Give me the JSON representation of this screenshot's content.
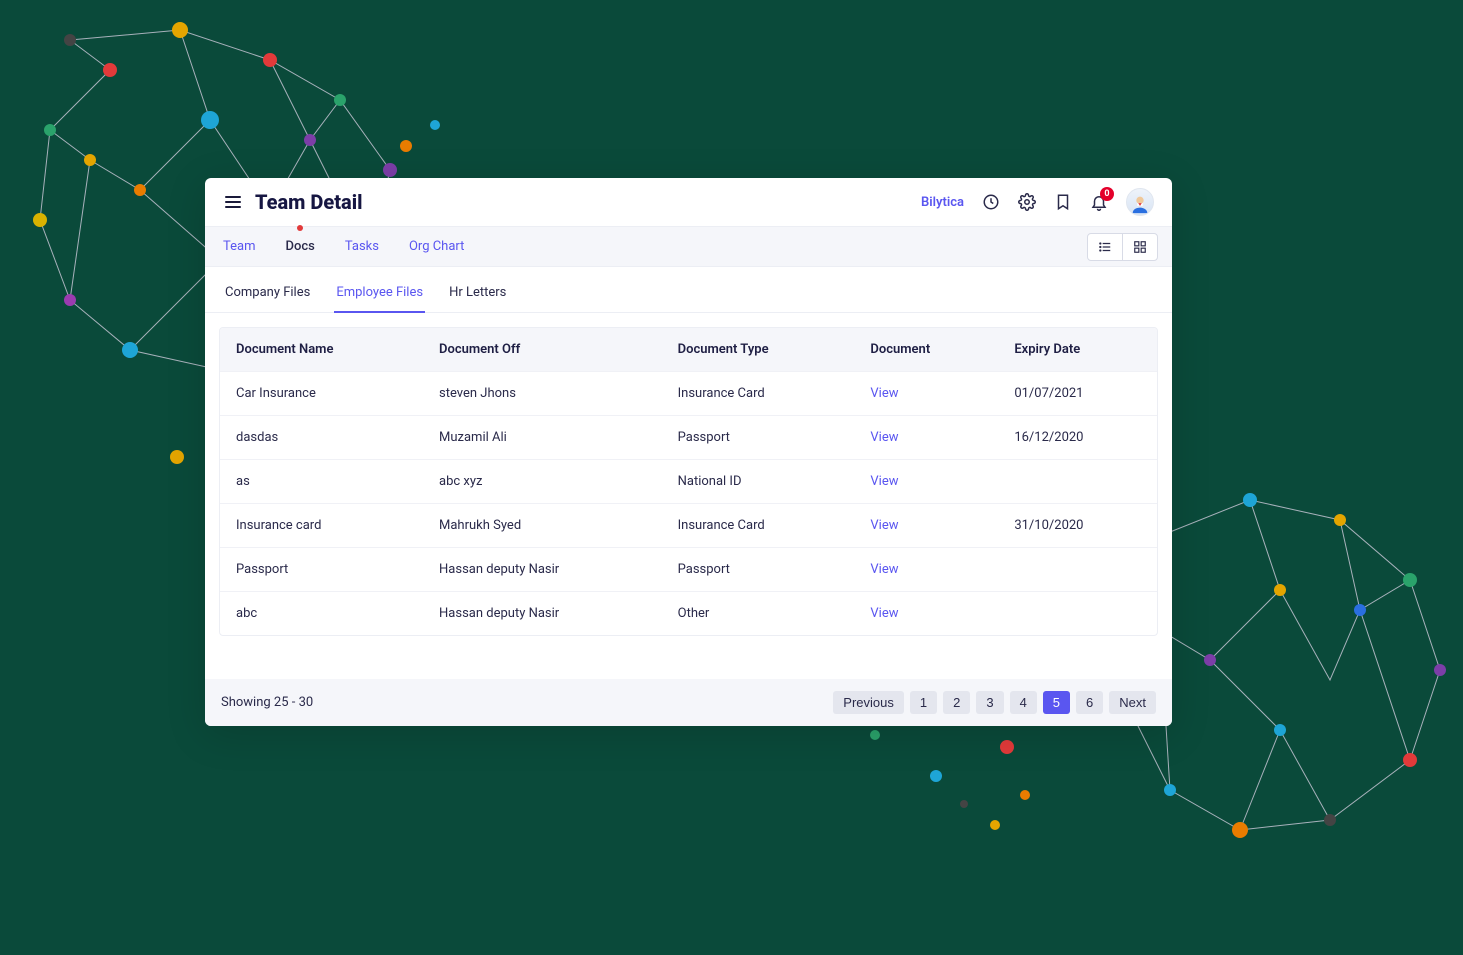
{
  "header": {
    "title": "Team Detail",
    "brand": "Bilytica",
    "notification_count": "0"
  },
  "nav": {
    "tabs": [
      "Team",
      "Docs",
      "Tasks",
      "Org Chart"
    ],
    "active": "Docs"
  },
  "subtabs": {
    "items": [
      "Company Files",
      "Employee Files",
      "Hr Letters"
    ],
    "active": "Employee Files"
  },
  "table": {
    "columns": [
      "Document Name",
      "Document Off",
      "Document Type",
      "Document",
      "Expiry Date"
    ],
    "view_label": "View",
    "rows": [
      {
        "name": "Car Insurance",
        "off": "steven Jhons",
        "type": "Insurance Card",
        "expiry": "01/07/2021"
      },
      {
        "name": "dasdas",
        "off": "Muzamil Ali",
        "type": "Passport",
        "expiry": "16/12/2020"
      },
      {
        "name": "as",
        "off": "abc xyz",
        "type": "National ID",
        "expiry": ""
      },
      {
        "name": "Insurance card",
        "off": "Mahrukh Syed",
        "type": "Insurance Card",
        "expiry": "31/10/2020"
      },
      {
        "name": "Passport",
        "off": "Hassan deputy Nasir",
        "type": "Passport",
        "expiry": ""
      },
      {
        "name": "abc",
        "off": "Hassan deputy Nasir",
        "type": "Other",
        "expiry": ""
      }
    ]
  },
  "footer": {
    "summary": "Showing 25 - 30",
    "prev": "Previous",
    "next": "Next",
    "pages": [
      "1",
      "2",
      "3",
      "4",
      "5",
      "6"
    ],
    "current": "5"
  }
}
